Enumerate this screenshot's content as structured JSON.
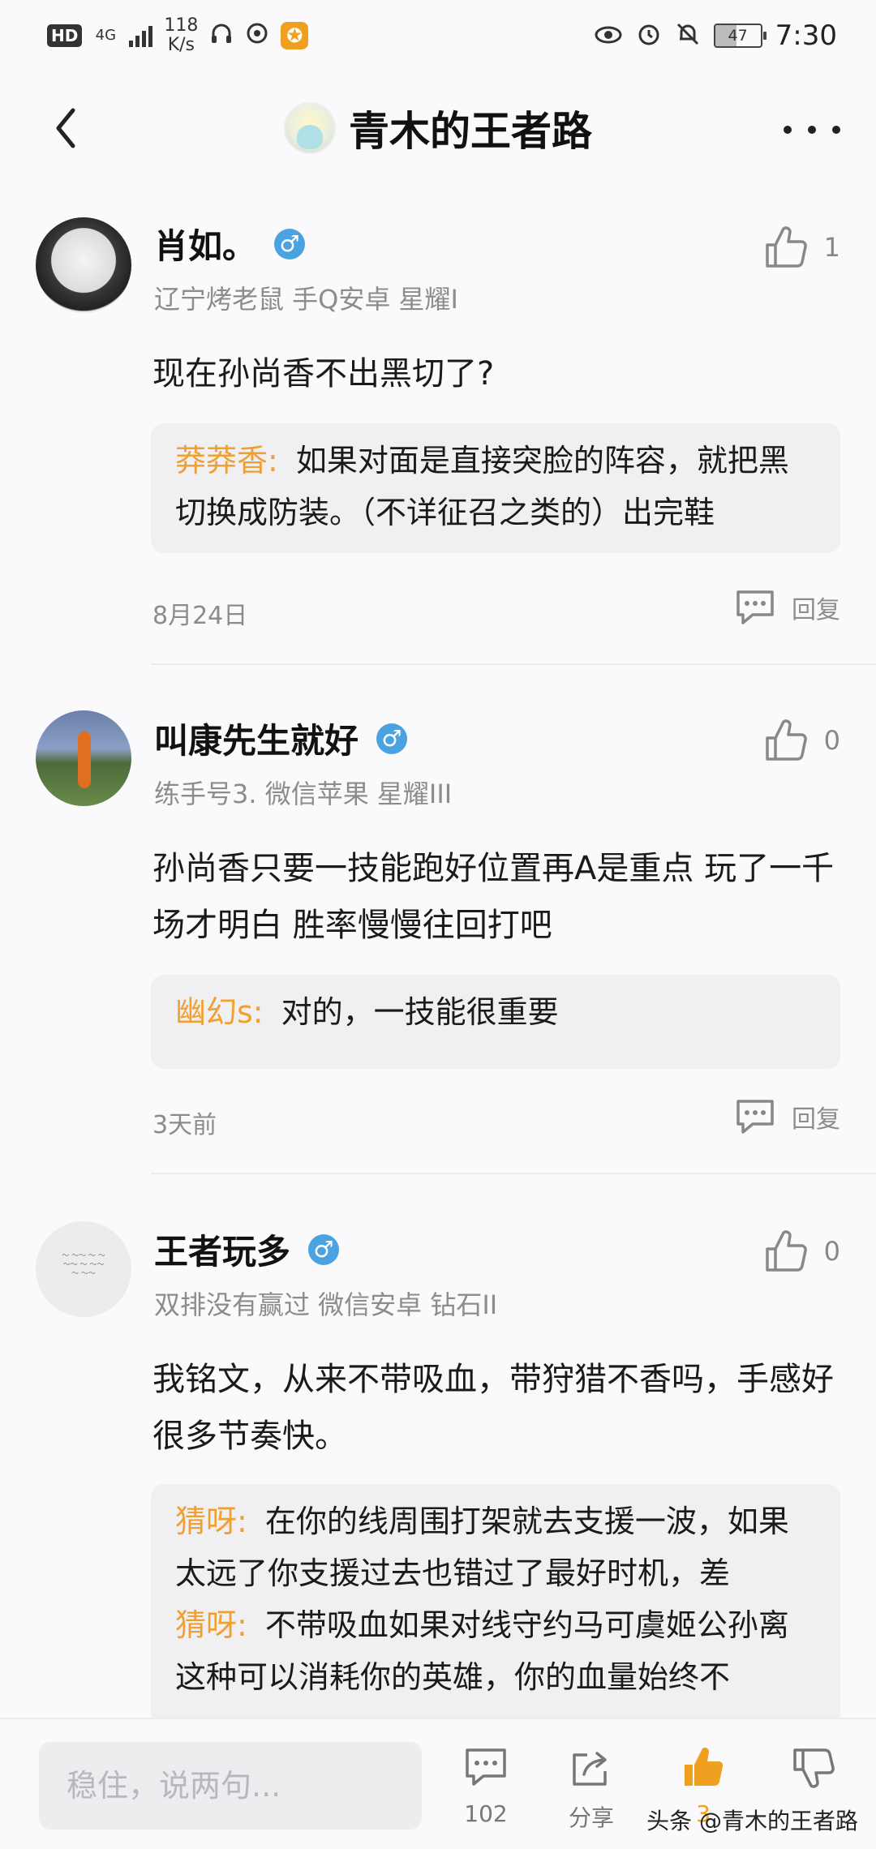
{
  "status_bar": {
    "hd": "HD",
    "network": "4G",
    "speed_value": "118",
    "speed_unit": "K/s",
    "battery": "47",
    "time": "7:30"
  },
  "header": {
    "title": "青木的王者路"
  },
  "comments": [
    {
      "name": "肖如。",
      "gender": "♂",
      "sub": "辽宁烤老鼠 手Q安卓 星耀I",
      "likes": "1",
      "text": "现在孙尚香不出黑切了?",
      "replies": [
        {
          "name": "莽莽香:",
          "text": "如果对面是直接突脸的阵容，就把黑切换成防装。（不详征召之类的）出完鞋"
        }
      ],
      "date": "8月24日",
      "reply_label": "回复"
    },
    {
      "name": "叫康先生就好",
      "gender": "♂",
      "sub": "练手号3. 微信苹果 星耀III",
      "likes": "0",
      "text": "孙尚香只要一技能跑好位置再A是重点 玩了一千场才明白 胜率慢慢往回打吧",
      "replies": [
        {
          "name": "幽幻s:",
          "text": "对的，一技能很重要"
        }
      ],
      "date": "3天前",
      "reply_label": "回复"
    },
    {
      "name": "王者玩多",
      "gender": "♂",
      "sub": "双排没有赢过 微信安卓 钻石II",
      "likes": "0",
      "text": "我铭文，从来不带吸血，带狩猎不香吗，手感好很多节奏快。",
      "replies": [
        {
          "name": "猜呀:",
          "text": "在你的线周围打架就去支援一波，如果太远了你支援过去也错过了最好时机，差"
        },
        {
          "name": "猜呀:",
          "text": "不带吸血如果对线守约马可虞姬公孙离这种可以消耗你的英雄，你的血量始终不"
        }
      ]
    }
  ],
  "bottom_bar": {
    "input_placeholder": "稳住，说两句...",
    "comment_count": "102",
    "share_label": "分享",
    "like_count": "3",
    "watermark": "头条 @青木的王者路"
  }
}
